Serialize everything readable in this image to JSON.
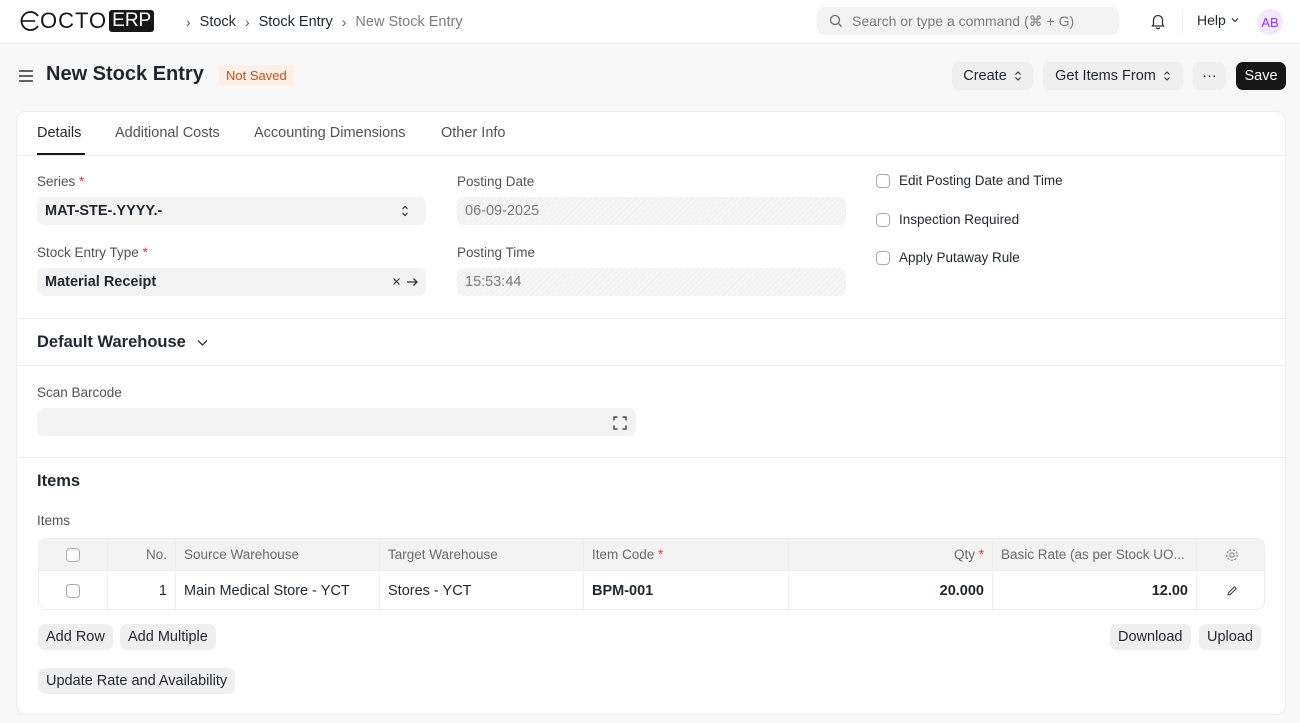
{
  "navbar": {
    "logo_text": "OCTO",
    "logo_badge": "ERP",
    "breadcrumbs": [
      "Stock",
      "Stock Entry",
      "New Stock Entry"
    ],
    "search_placeholder": "Search or type a command (⌘ + G)",
    "help_label": "Help",
    "avatar_initials": "AB"
  },
  "page": {
    "title": "New Stock Entry",
    "status": "Not Saved",
    "create_label": "Create",
    "get_items_label": "Get Items From",
    "more_label": "···",
    "save_label": "Save"
  },
  "tabs": [
    "Details",
    "Additional Costs",
    "Accounting Dimensions",
    "Other Info"
  ],
  "form": {
    "series_label": "Series",
    "series_value": "MAT-STE-.YYYY.-",
    "entry_type_label": "Stock Entry Type",
    "entry_type_value": "Material Receipt",
    "posting_date_label": "Posting Date",
    "posting_date_value": "06-09-2025",
    "posting_time_label": "Posting Time",
    "posting_time_value": "15:53:44",
    "checks": [
      "Edit Posting Date and Time",
      "Inspection Required",
      "Apply Putaway Rule"
    ]
  },
  "default_warehouse": {
    "title": "Default Warehouse"
  },
  "scan": {
    "label": "Scan Barcode",
    "value": ""
  },
  "items_section": {
    "title": "Items",
    "table_label": "Items",
    "columns": {
      "no": "No.",
      "source": "Source Warehouse",
      "target": "Target Warehouse",
      "item_code": "Item Code",
      "qty": "Qty",
      "rate": "Basic Rate (as per Stock UO..."
    },
    "rows": [
      {
        "no": "1",
        "source": "Main Medical Store - YCT",
        "target": "Stores - YCT",
        "item_code": "BPM-001",
        "qty": "20.000",
        "rate": "12.00"
      }
    ],
    "add_row": "Add Row",
    "add_multiple": "Add Multiple",
    "download": "Download",
    "upload": "Upload",
    "update_rate": "Update Rate and Availability"
  },
  "colors": {
    "accent": "#171717",
    "badge_bg": "#fcefe6",
    "badge_text": "#c44e21",
    "required": "#e03636",
    "avatar_bg": "#f3e8ff",
    "avatar_text": "#9333ea"
  }
}
